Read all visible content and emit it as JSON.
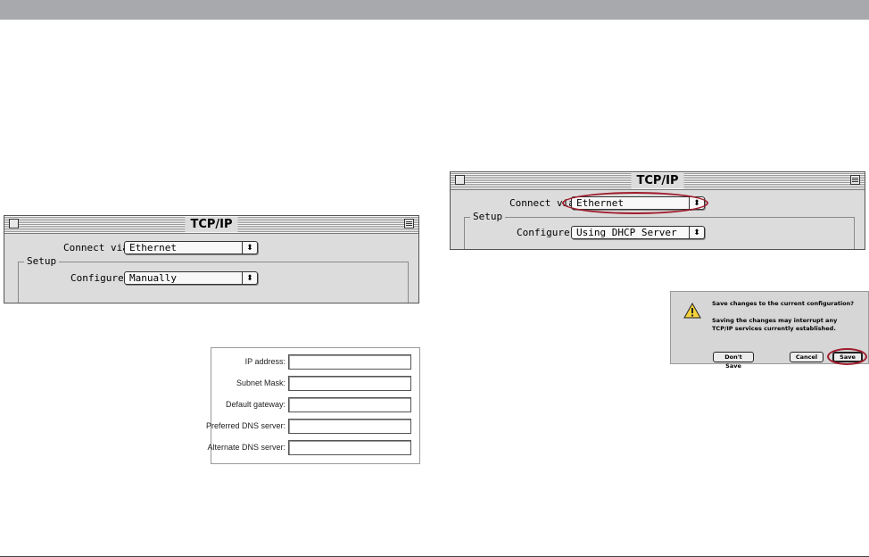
{
  "window_left": {
    "title": "TCP/IP",
    "connect_via_label": "Connect via :",
    "connect_via_value": "Ethernet",
    "setup_label": "Setup",
    "configure_label": "Configure :",
    "configure_value": "Manually"
  },
  "window_right": {
    "title": "TCP/IP",
    "connect_via_label": "Connect via :",
    "connect_via_value": "Ethernet",
    "setup_label": "Setup",
    "configure_label": "Configure :",
    "configure_value": "Using DHCP Server"
  },
  "ip_form": {
    "fields": [
      {
        "label": "IP address:",
        "value": ""
      },
      {
        "label": "Subnet Mask:",
        "value": ""
      },
      {
        "label": "Default gateway:",
        "value": ""
      },
      {
        "label": "Preferred DNS server:",
        "value": ""
      },
      {
        "label": "Alternate DNS server:",
        "value": ""
      }
    ]
  },
  "dialog": {
    "title": "Save changes to the current configuration?",
    "message": "Saving the changes may interrupt any TCP/IP services currently established.",
    "dont_save_label": "Don't Save",
    "cancel_label": "Cancel",
    "save_label": "Save",
    "icon": "warning-icon"
  },
  "colors": {
    "highlight": "#a01c2c",
    "top_bar": "#a7a9ac"
  }
}
